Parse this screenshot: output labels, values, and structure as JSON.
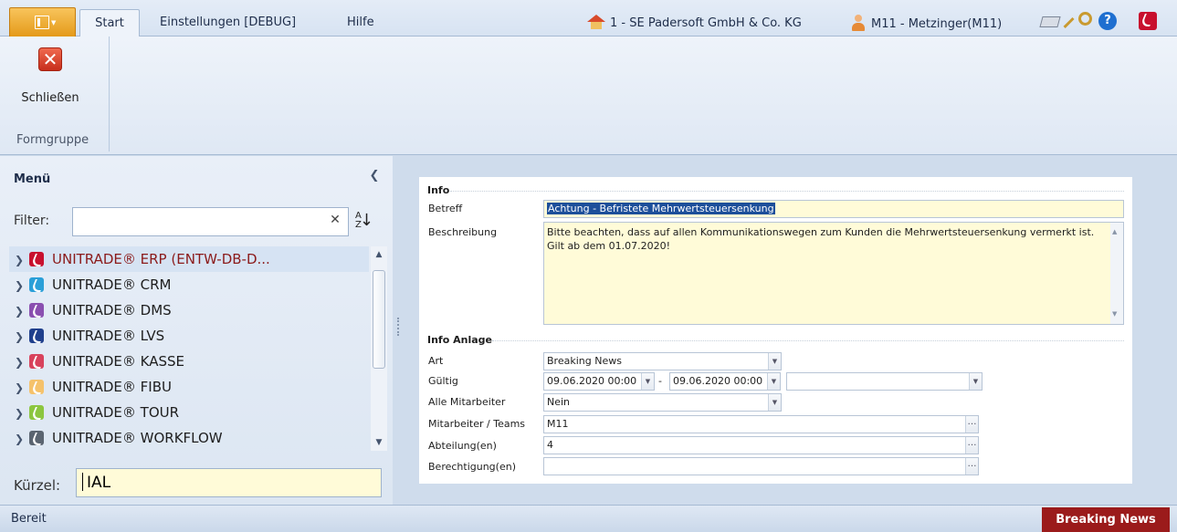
{
  "ribbon": {
    "tabs": [
      "Start",
      "Einstellungen [DEBUG]",
      "Hilfe"
    ],
    "company": "1 - SE Padersoft GmbH & Co. KG",
    "user": "M11 - Metzinger(M11)",
    "close_label": "Schließen",
    "group_label": "Formgruppe"
  },
  "menu": {
    "title": "Menü",
    "filter_label": "Filter:",
    "filter_value": "",
    "items": [
      {
        "label": "UNITRADE® ERP (ENTW-DB-D...",
        "color": "#c8102e",
        "selected": true
      },
      {
        "label": "UNITRADE® CRM",
        "color": "#2a9fd8"
      },
      {
        "label": "UNITRADE® DMS",
        "color": "#8a4fb0"
      },
      {
        "label": "UNITRADE® LVS",
        "color": "#1f3f8c"
      },
      {
        "label": "UNITRADE® KASSE",
        "color": "#d8425c"
      },
      {
        "label": "UNITRADE® FIBU",
        "color": "#f5c26b"
      },
      {
        "label": "UNITRADE® TOUR",
        "color": "#8cc63f"
      },
      {
        "label": "UNITRADE® WORKFLOW",
        "color": "#5a6470"
      }
    ],
    "kuerzel_label": "Kürzel:",
    "kuerzel_value": "IAL"
  },
  "form": {
    "info": {
      "title": "Info",
      "betreff_label": "Betreff",
      "betreff_value": "Achtung - Befristete Mehrwertsteuersenkung",
      "beschreibung_label": "Beschreibung",
      "beschreibung_value": "Bitte beachten, dass auf allen Kommunikationswegen zum Kunden die Mehrwertsteuersenkung vermerkt ist. Gilt ab dem 01.07.2020!"
    },
    "anlage": {
      "title": "Info Anlage",
      "art_label": "Art",
      "art_value": "Breaking News",
      "gueltig_label": "Gültig",
      "gueltig_from": "09.06.2020 00:00",
      "gueltig_separator": "-",
      "gueltig_to": "09.06.2020 00:00",
      "gueltig_extra": "",
      "alle_label": "Alle Mitarbeiter",
      "alle_value": "Nein",
      "mitarbeiter_label": "Mitarbeiter / Teams",
      "mitarbeiter_value": "M11",
      "abteilung_label": "Abteilung(en)",
      "abteilung_value": "4",
      "berechtigung_label": "Berechtigung(en)",
      "berechtigung_value": ""
    }
  },
  "status": {
    "text": "Bereit",
    "badge": "Breaking News"
  },
  "colors": {
    "accent": "#1d4f9a",
    "badge": "#9b1b1b",
    "highlight": "#fffbd8"
  }
}
